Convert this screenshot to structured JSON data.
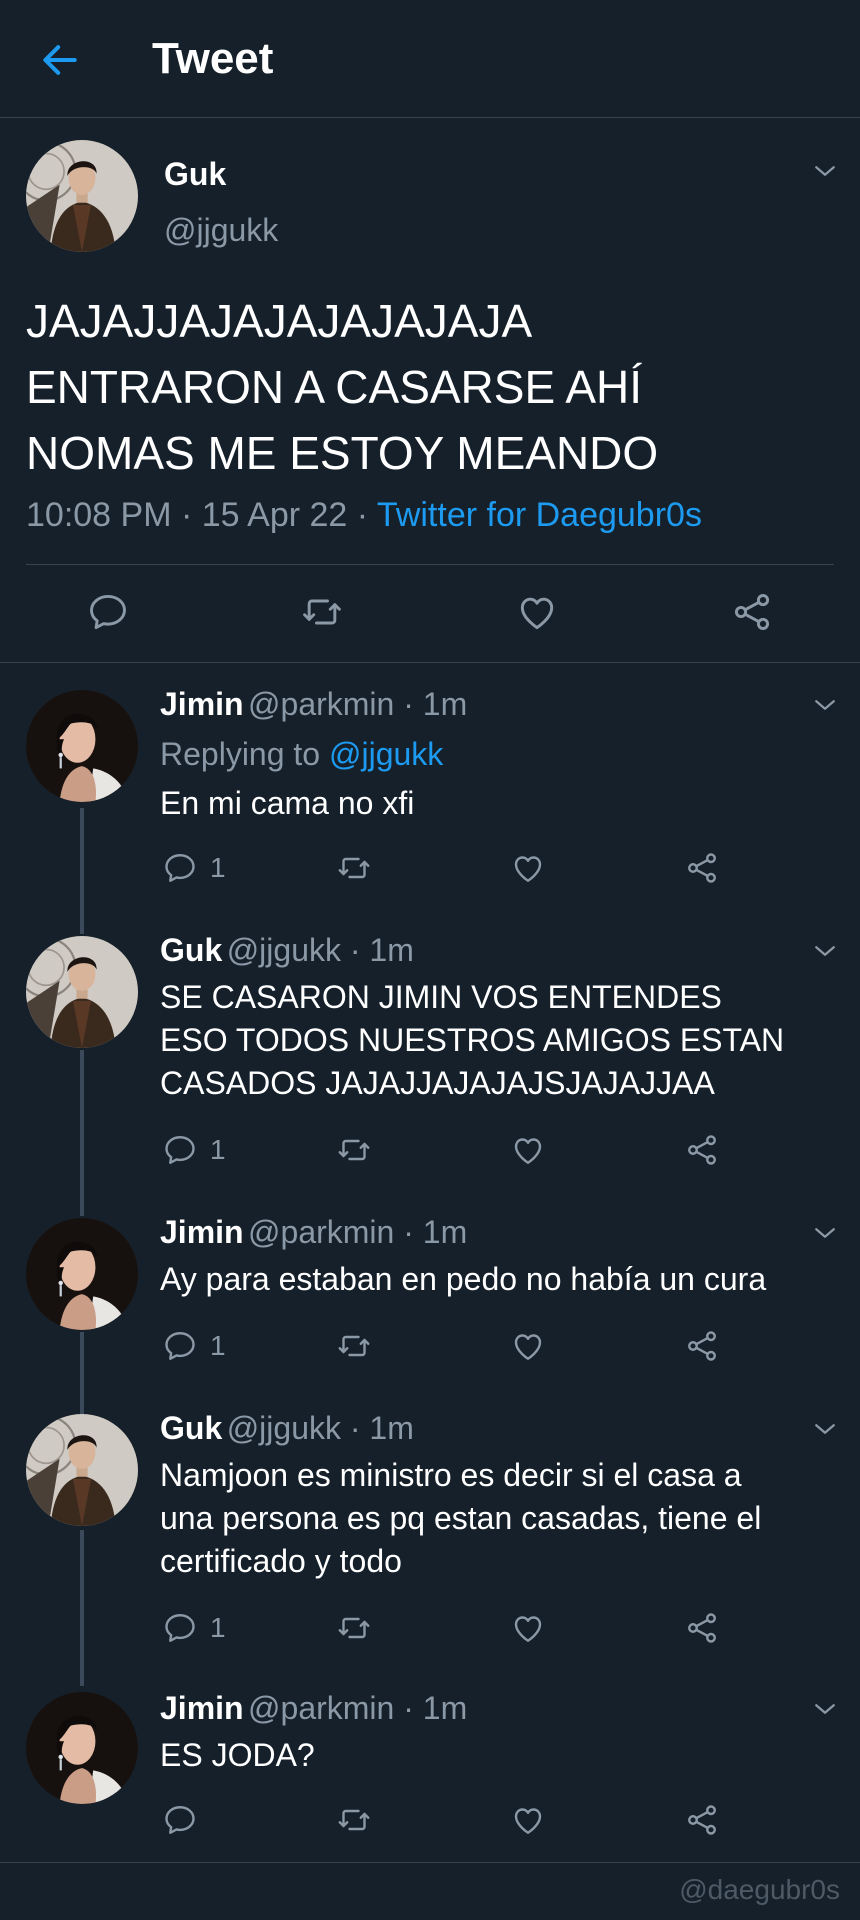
{
  "header": {
    "title": "Tweet"
  },
  "main_tweet": {
    "name": "Guk",
    "handle": "@jjgukk",
    "text_lines": [
      "JAJAJJAJAJAJAJAJAJA",
      "ENTRARON A CASARSE AHÍ",
      "NOMAS ME ESTOY MEANDO"
    ],
    "time": "10:08 PM",
    "sep1": " · ",
    "date": "15 Apr 22",
    "sep2": " · ",
    "source": "Twitter for Daegubr0s"
  },
  "replies": [
    {
      "name": "Jimin",
      "handle": "@parkmin · 1m",
      "replying_prefix": "Replying to ",
      "replying_handle": "@jjgukk",
      "text": "En mi cama no xfi",
      "reply_count": "1"
    },
    {
      "name": "Guk",
      "handle": "@jjgukk · 1m",
      "text_lines": [
        "SE CASARON JIMIN VOS ENTENDES",
        "ESO TODOS NUESTROS AMIGOS ESTAN",
        "CASADOS JAJAJJAJAJAJSJAJAJJAA"
      ],
      "reply_count": "1"
    },
    {
      "name": "Jimin",
      "handle": "@parkmin · 1m",
      "text": "Ay para estaban en pedo no había un cura",
      "reply_count": "1"
    },
    {
      "name": "Guk",
      "handle": "@jjgukk · 1m",
      "text_lines": [
        "Namjoon es ministro es decir si el casa a",
        "una persona es pq estan casadas, tiene el",
        "certificado y todo"
      ],
      "reply_count": "1"
    },
    {
      "name": "Jimin",
      "handle": "@parkmin · 1m",
      "text": "ES JODA?"
    }
  ],
  "watermark": "@daegubr0s",
  "colors": {
    "background": "#15202b",
    "accent": "#1d9bf0",
    "muted": "#8b98a5",
    "divider": "#38444d"
  }
}
